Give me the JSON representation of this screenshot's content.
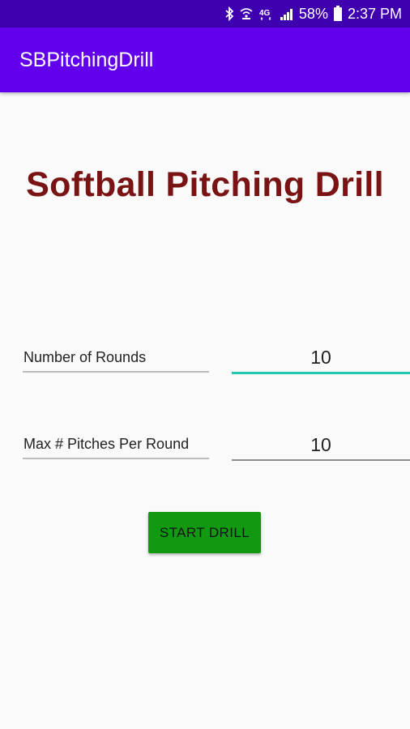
{
  "status_bar": {
    "battery_percent": "58%",
    "time": "2:37 PM",
    "network_label": "4G",
    "icons": [
      "bluetooth-icon",
      "wifi-calling-icon",
      "lte-icon",
      "signal-icon",
      "battery-icon"
    ]
  },
  "app_bar": {
    "title": "SBPitchingDrill"
  },
  "main": {
    "heading": "Softball Pitching Drill",
    "fields": [
      {
        "label": "Number of Rounds",
        "value": "10",
        "focused": true
      },
      {
        "label": "Max # Pitches Per Round",
        "value": "10",
        "focused": false
      }
    ],
    "start_button_label": "START DRILL"
  },
  "colors": {
    "status_bar": "#3f00b0",
    "app_bar": "#6200ee",
    "heading": "#7a1414",
    "focus_underline": "#1fc7b4",
    "button": "#119a11",
    "background": "#fafafa"
  }
}
